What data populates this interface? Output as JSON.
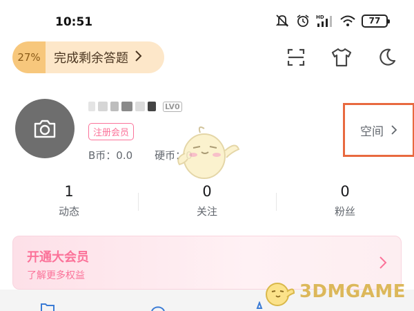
{
  "status_bar": {
    "time": "10:51",
    "battery": "77",
    "network_label": "HD"
  },
  "task_banner": {
    "percent": "27%",
    "label": "完成剩余答题"
  },
  "profile": {
    "level": "LV0",
    "member_tag": "注册会员",
    "b_coin": "B币：0.0",
    "hard_coin": "硬币：0",
    "space_label": "空间"
  },
  "stats": [
    {
      "value": "1",
      "label": "动态"
    },
    {
      "value": "0",
      "label": "关注"
    },
    {
      "value": "0",
      "label": "粉丝"
    }
  ],
  "vip": {
    "title": "开通大会员",
    "subtitle": "了解更多权益"
  },
  "watermark": "3DMGAME",
  "colors": {
    "accent_pink": "#fb7299",
    "highlight_orange": "#e8693f",
    "task_orange": "#f7c77c"
  }
}
